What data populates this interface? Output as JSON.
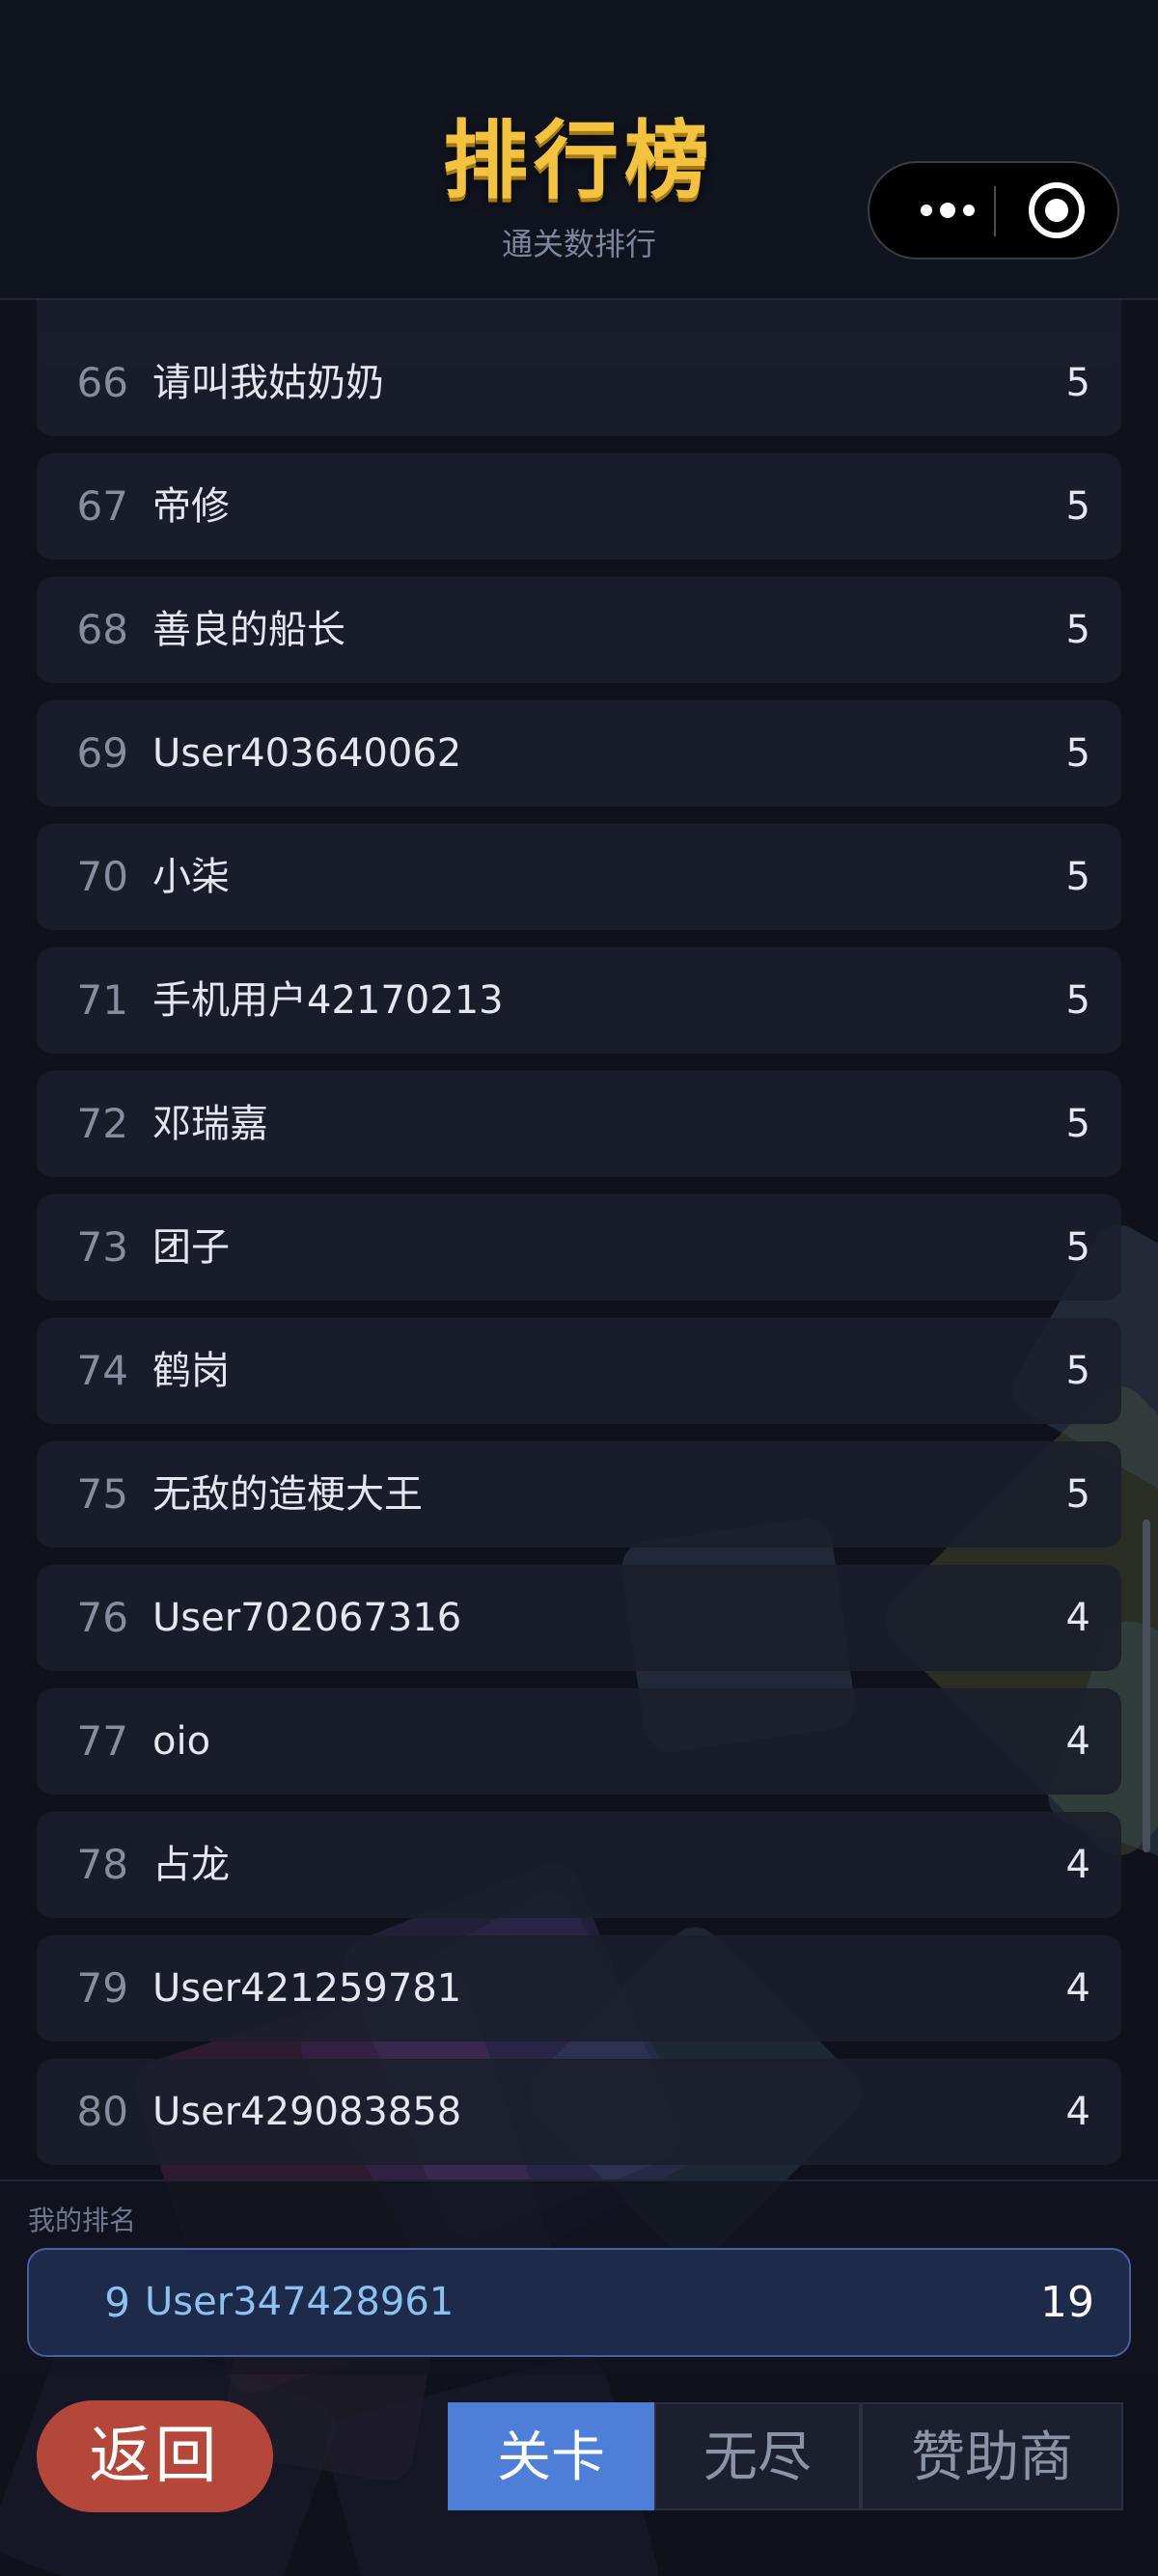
{
  "header": {
    "title": "排行榜",
    "subtitle": "通关数排行"
  },
  "capsule": {
    "more_icon": "more-dots-icon",
    "close_icon": "target-circle-icon"
  },
  "leaderboard": [
    {
      "rank": "66",
      "name": "请叫我姑奶奶",
      "score": "5"
    },
    {
      "rank": "67",
      "name": "帝修",
      "score": "5"
    },
    {
      "rank": "68",
      "name": "善良的船长",
      "score": "5"
    },
    {
      "rank": "69",
      "name": "User403640062",
      "score": "5"
    },
    {
      "rank": "70",
      "name": "小柒",
      "score": "5"
    },
    {
      "rank": "71",
      "name": "手机用户42170213",
      "score": "5"
    },
    {
      "rank": "72",
      "name": "邓瑞嘉",
      "score": "5"
    },
    {
      "rank": "73",
      "name": "团子",
      "score": "5"
    },
    {
      "rank": "74",
      "name": "鹤岗",
      "score": "5"
    },
    {
      "rank": "75",
      "name": "无敌的造梗大王",
      "score": "5"
    },
    {
      "rank": "76",
      "name": "User702067316",
      "score": "4"
    },
    {
      "rank": "77",
      "name": "oio",
      "score": "4"
    },
    {
      "rank": "78",
      "name": "占龙",
      "score": "4"
    },
    {
      "rank": "79",
      "name": "User421259781",
      "score": "4"
    },
    {
      "rank": "80",
      "name": "User429083858",
      "score": "4"
    }
  ],
  "my_rank": {
    "label": "我的排名",
    "rank": "9",
    "name": "User347428961",
    "score": "19"
  },
  "bottom": {
    "back_label": "返回",
    "tabs": [
      {
        "label": "关卡",
        "active": true
      },
      {
        "label": "无尽",
        "active": false
      },
      {
        "label": "赞助商",
        "active": false
      }
    ]
  },
  "colors": {
    "accent": "#4d7fd9",
    "title_gold": "#f3c33f",
    "back_button": "#b5473a"
  }
}
